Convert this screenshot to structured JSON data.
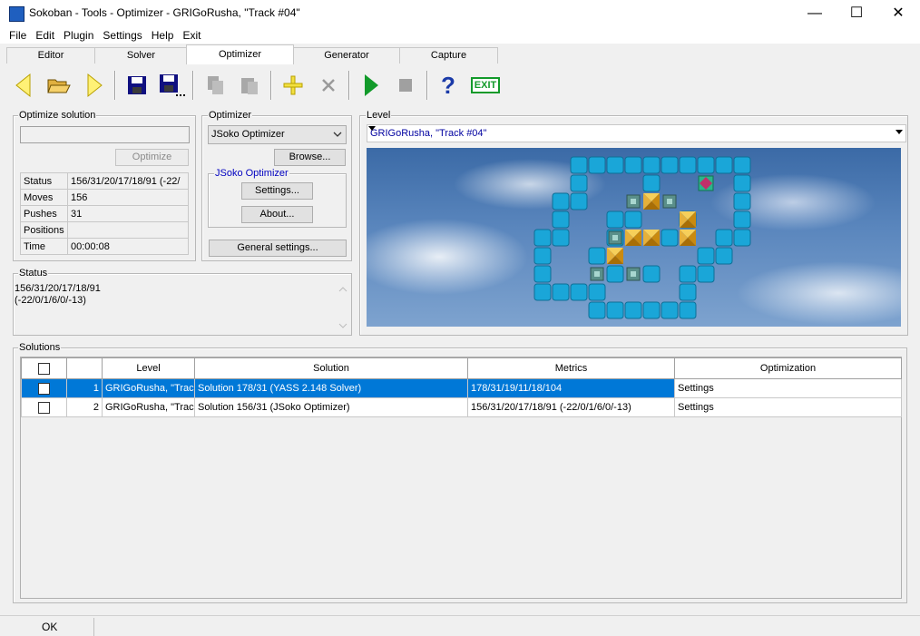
{
  "window": {
    "title": "Sokoban - Tools - Optimizer - GRIGoRusha, \"Track #04\"",
    "minimize": "—",
    "maximize": "☐",
    "close": "✕"
  },
  "menu": [
    "File",
    "Edit",
    "Plugin",
    "Settings",
    "Help",
    "Exit"
  ],
  "tabs": [
    "Editor",
    "Solver",
    "Optimizer",
    "Generator",
    "Capture"
  ],
  "active_tab": "Optimizer",
  "toolbar": {
    "exit_label": "EXIT",
    "help_label": "?"
  },
  "optimize_solution": {
    "group_label": "Optimize solution",
    "optimize_button": "Optimize",
    "rows": [
      {
        "label": "Status",
        "value": "156/31/20/17/18/91  (-22/"
      },
      {
        "label": "Moves",
        "value": "156"
      },
      {
        "label": "Pushes",
        "value": "31"
      },
      {
        "label": "Positions",
        "value": ""
      },
      {
        "label": "Time",
        "value": "00:00:08"
      }
    ]
  },
  "optimizer": {
    "group_label": "Optimizer",
    "selected": "JSoko Optimizer",
    "browse_button": "Browse...",
    "sub_group_label": "JSoko Optimizer",
    "settings_button": "Settings...",
    "about_button": "About...",
    "general_settings_button": "General settings..."
  },
  "status": {
    "group_label": "Status",
    "line1": "156/31/20/17/18/91",
    "line2": "(-22/0/1/6/0/-13)"
  },
  "level": {
    "group_label": "Level",
    "selected": "GRIGoRusha, \"Track #04\""
  },
  "solutions": {
    "group_label": "Solutions",
    "columns": [
      "",
      "",
      "Level",
      "Solution",
      "Metrics",
      "Optimization"
    ],
    "rows": [
      {
        "num": "1",
        "level": "GRIGoRusha, \"Trac",
        "solution": "Solution 178/31 (YASS 2.148 Solver)",
        "metrics": "178/31/19/11/18/104",
        "optimization": "Settings",
        "selected": true
      },
      {
        "num": "2",
        "level": "GRIGoRusha, \"Trac",
        "solution": "Solution 156/31 (JSoko Optimizer)",
        "metrics": "156/31/20/17/18/91  (-22/0/1/6/0/-13)",
        "optimization": "Settings",
        "selected": false
      }
    ]
  },
  "statusbar": {
    "text": "OK"
  },
  "colors": {
    "selection": "#0078d7",
    "tile": "#1aa6d8",
    "box": "#d9a21e",
    "goal": "#5a8f8a",
    "player": "#c0306a",
    "level_text": "#0000a0"
  },
  "board": {
    "walls": [
      [
        11,
        0
      ],
      [
        12,
        0
      ],
      [
        13,
        0
      ],
      [
        14,
        0
      ],
      [
        15,
        0
      ],
      [
        16,
        0
      ],
      [
        17,
        0
      ],
      [
        18,
        0
      ],
      [
        19,
        0
      ],
      [
        20,
        0
      ],
      [
        11,
        1
      ],
      [
        15,
        1
      ],
      [
        20,
        1
      ],
      [
        10,
        2
      ],
      [
        11,
        2
      ],
      [
        20,
        2
      ],
      [
        10,
        3
      ],
      [
        13,
        3
      ],
      [
        14,
        3
      ],
      [
        17,
        3
      ],
      [
        20,
        3
      ],
      [
        9,
        4
      ],
      [
        10,
        4
      ],
      [
        13,
        4
      ],
      [
        16,
        4
      ],
      [
        19,
        4
      ],
      [
        20,
        4
      ],
      [
        9,
        5
      ],
      [
        12,
        5
      ],
      [
        18,
        5
      ],
      [
        19,
        5
      ],
      [
        9,
        6
      ],
      [
        13,
        6
      ],
      [
        15,
        6
      ],
      [
        17,
        6
      ],
      [
        18,
        6
      ],
      [
        9,
        7
      ],
      [
        10,
        7
      ],
      [
        11,
        7
      ],
      [
        12,
        7
      ],
      [
        17,
        7
      ],
      [
        12,
        8
      ],
      [
        13,
        8
      ],
      [
        14,
        8
      ],
      [
        15,
        8
      ],
      [
        16,
        8
      ],
      [
        17,
        8
      ]
    ],
    "boxes": [
      [
        15,
        2
      ],
      [
        17,
        3
      ],
      [
        14,
        4
      ],
      [
        15,
        4
      ],
      [
        17,
        4
      ],
      [
        13,
        5
      ]
    ],
    "goals": [
      [
        14,
        2
      ],
      [
        16,
        2
      ],
      [
        13,
        4
      ],
      [
        12,
        6
      ],
      [
        14,
        6
      ]
    ],
    "player": [
      18,
      1
    ]
  }
}
